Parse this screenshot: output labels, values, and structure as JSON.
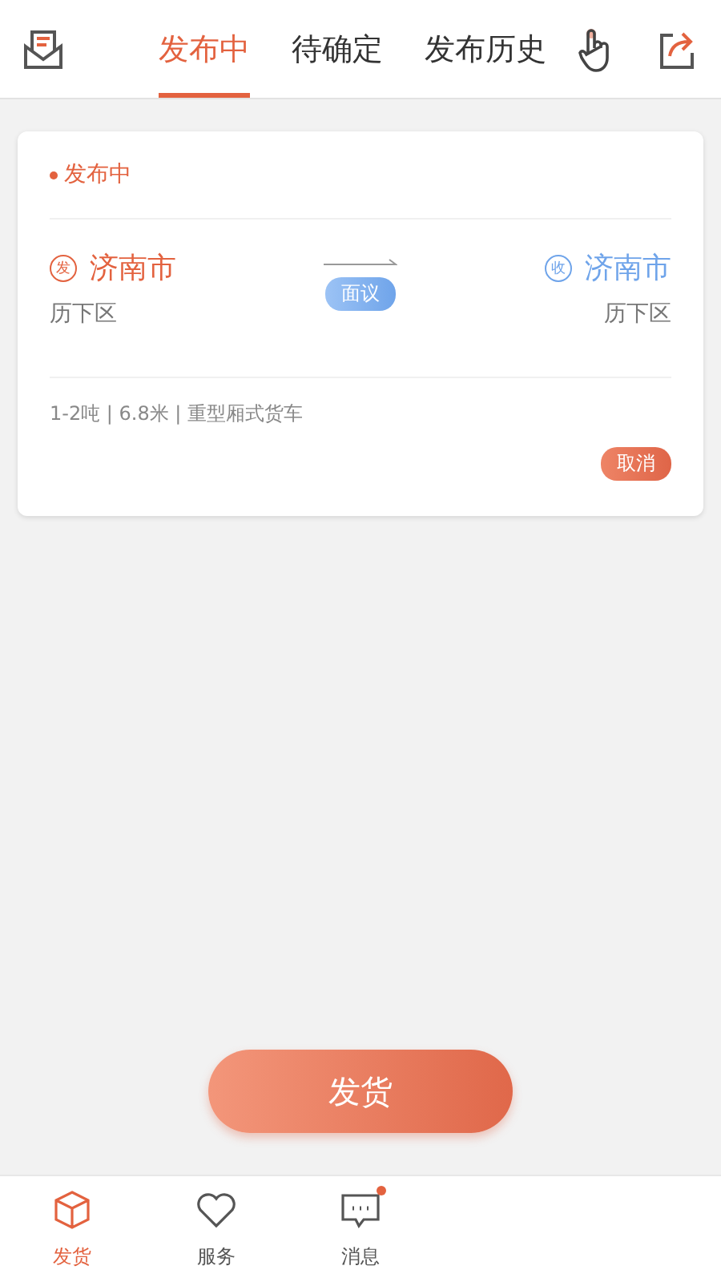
{
  "tabs": [
    {
      "label": "发布中",
      "selected": true
    },
    {
      "label": "待确定",
      "selected": false
    },
    {
      "label": "发布历史",
      "selected": false
    }
  ],
  "order": {
    "status": "发布中",
    "from": {
      "mark": "发",
      "city": "济南市",
      "district": "历下区"
    },
    "to": {
      "mark": "收",
      "city": "济南市",
      "district": "历下区"
    },
    "price": "面议",
    "specs": "1-2吨 | 6.8米 | 重型厢式货车",
    "cancel": "取消"
  },
  "primary_button": "发货",
  "nav": [
    {
      "label": "发货",
      "kind": "box",
      "selected": true,
      "dot": false
    },
    {
      "label": "服务",
      "kind": "heart",
      "selected": false,
      "dot": false
    },
    {
      "label": "消息",
      "kind": "chat",
      "selected": false,
      "dot": true
    }
  ]
}
